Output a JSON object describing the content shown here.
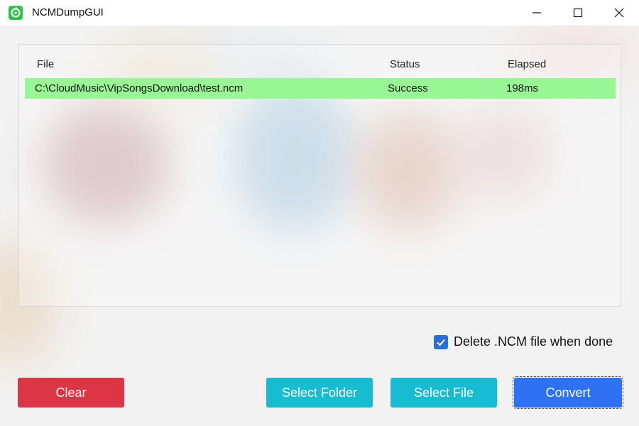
{
  "window": {
    "title": "NCMDumpGUI",
    "icon": "netease-music-icon",
    "controls": [
      "minimize-icon",
      "maximize-icon",
      "close-icon"
    ]
  },
  "file_list": {
    "columns": [
      "File",
      "Status",
      "Elapsed"
    ],
    "rows": [
      {
        "file": "C:\\CloudMusic\\VipSongsDownload\\test.ncm",
        "status": "Success",
        "elapsed": "198ms"
      }
    ],
    "success_color": "#98f794"
  },
  "options": {
    "delete_ncm_label": "Delete .NCM file when done",
    "delete_ncm_checked": true
  },
  "buttons": {
    "clear": "Clear",
    "select_folder": "Select Folder",
    "select_file": "Select File",
    "convert": "Convert"
  },
  "colors": {
    "clear": "#dc3545",
    "select": "#17bcd2",
    "convert": "#2e72f3",
    "checkbox": "#2a6fd8"
  }
}
